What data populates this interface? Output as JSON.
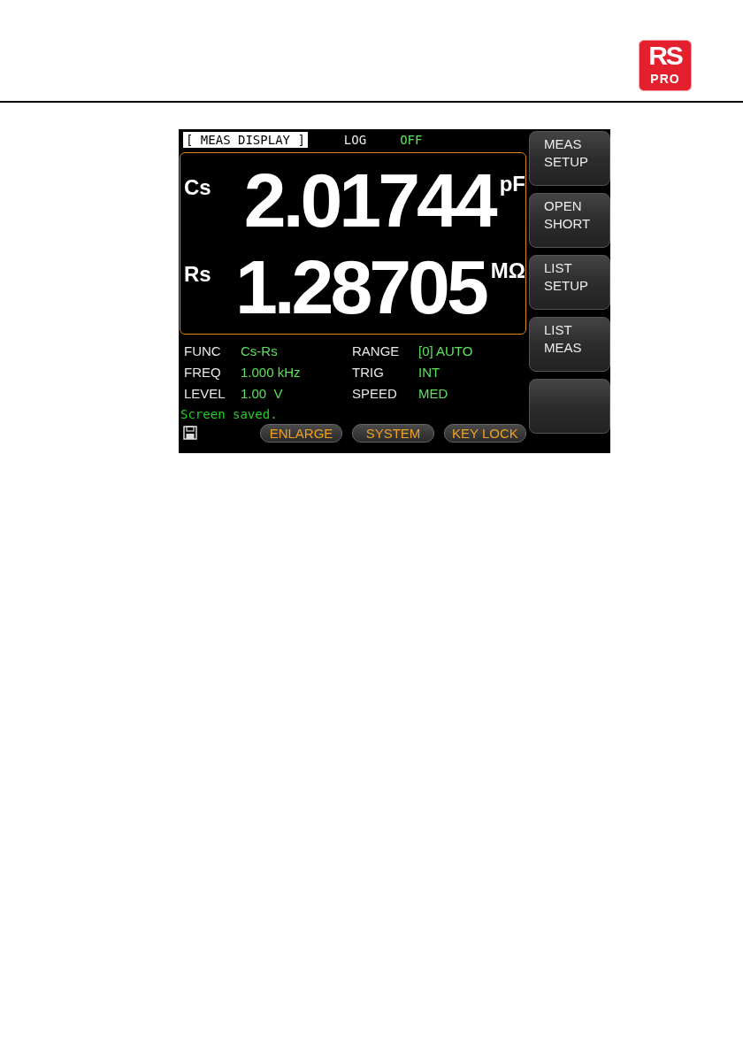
{
  "logo": {
    "top": "RS",
    "bottom": "PRO"
  },
  "screen": {
    "title": "[ MEAS DISPLAY ]",
    "log": {
      "label": "LOG",
      "value": "OFF"
    },
    "readings": [
      {
        "param": "Cs",
        "value": "2.01744",
        "unit": "pF"
      },
      {
        "param": "Rs",
        "value": "1.28705",
        "unit": "MΩ"
      }
    ],
    "settings": [
      {
        "label": "FUNC",
        "value": "Cs-Rs"
      },
      {
        "label": "RANGE",
        "value": "[0] AUTO"
      },
      {
        "label": "FREQ",
        "value": "1.000 kHz"
      },
      {
        "label": "TRIG",
        "value": "INT"
      },
      {
        "label": "LEVEL",
        "value": "1.00  V"
      },
      {
        "label": "SPEED",
        "value": "MED"
      }
    ],
    "message": "Screen saved.",
    "bottom_buttons": [
      "ENLARGE",
      "SYSTEM",
      "KEY LOCK"
    ],
    "softkeys": [
      {
        "kind": "label",
        "lines": [
          "MEAS",
          "SETUP"
        ]
      },
      {
        "kind": "label",
        "lines": [
          "OPEN",
          "SHORT"
        ]
      },
      {
        "kind": "label",
        "lines": [
          "LIST",
          "SETUP"
        ]
      },
      {
        "kind": "label",
        "lines": [
          "LIST",
          "MEAS"
        ]
      },
      {
        "kind": "blank"
      }
    ]
  }
}
